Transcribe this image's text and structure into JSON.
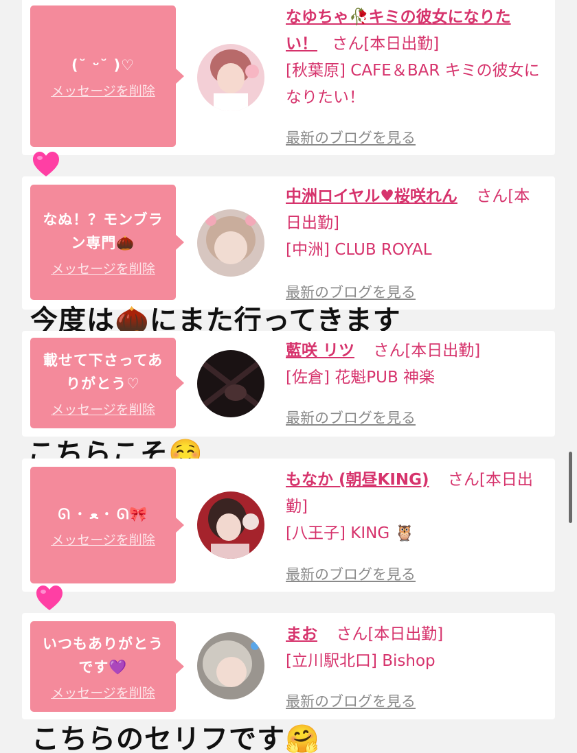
{
  "cards": [
    {
      "message": "(˘ ᵕ˘ )♡",
      "delete_label": "メッセージを削除",
      "name": "なゆちゃ🥀キミの彼女になりたい！",
      "suffix": "さん[本日出勤]",
      "place": "[秋葉原] CAFE＆BAR キミの彼女になりたい！",
      "blog_label": "最新のブログを見る"
    },
    {
      "message": "なぬ！？モンブラン専門🌰",
      "delete_label": "メッセージを削除",
      "name": "中洲ロイヤル♥桜咲れん",
      "suffix": "さん[本日出勤]",
      "place": "[中洲] CLUB ROYAL",
      "blog_label": "最新のブログを見る"
    },
    {
      "message": "載せて下さってありがとう♡",
      "delete_label": "メッセージを削除",
      "name": "藍咲 リツ",
      "suffix": "さん[本日出勤]",
      "place": "[佐倉] 花魁PUB 神楽",
      "blog_label": "最新のブログを見る"
    },
    {
      "message": "ᘏ ･ ﻌ ･ ᘏ🎀",
      "delete_label": "メッセージを削除",
      "name": "もなか (朝昼KING)",
      "suffix": "さん[本日出勤]",
      "place": "[八王子] KING 🦉",
      "blog_label": "最新のブログを見る"
    },
    {
      "message": "いつもありがとうです💜",
      "delete_label": "メッセージを削除",
      "name": "まお",
      "suffix": "さん[本日出勤]",
      "place": "[立川駅北口] Bishop",
      "blog_label": "最新のブログを見る"
    }
  ],
  "comments": {
    "c1": "今度は🌰にまた行ってきます",
    "c2": "こちらこそ☺️",
    "c3": "こちらのセリフです🤗"
  },
  "icons": {
    "heart": "pink-heart-icon",
    "chestnut": "chestnut-icon",
    "pointing": "pointing-hand-icon"
  },
  "colors": {
    "bubble": "#f48a9b",
    "name": "#d6336c",
    "heart": "#ff3fa4"
  }
}
